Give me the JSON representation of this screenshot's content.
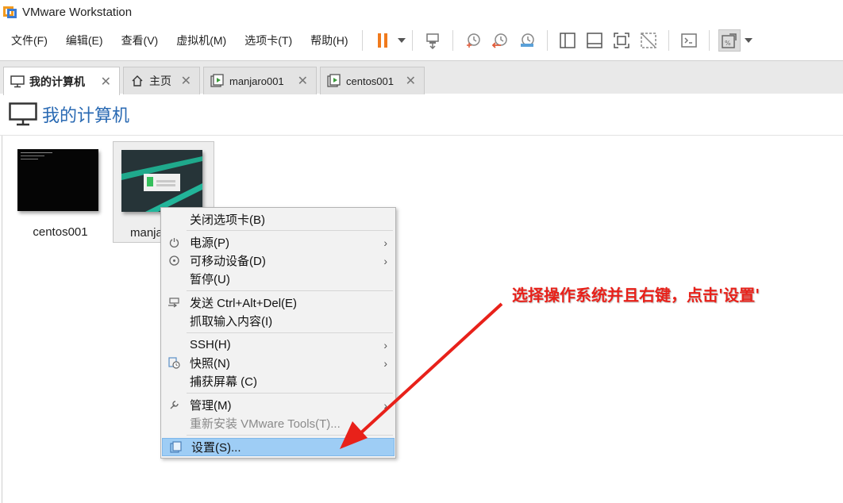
{
  "window": {
    "title": "VMware Workstation"
  },
  "menu": [
    "文件(F)",
    "编辑(E)",
    "查看(V)",
    "虚拟机(M)",
    "选项卡(T)",
    "帮助(H)"
  ],
  "toolbar": {
    "icons": [
      "suspend-icon",
      "send-ctrl-alt-del-icon",
      "snapshot-icon",
      "revert-snapshot-icon",
      "snapshot-manager-icon",
      "library-view-icon",
      "thumbnail-bar-icon",
      "full-screen-icon",
      "unity-icon",
      "console-icon",
      "stretch-guest-icon"
    ],
    "accent": "#f07a1d"
  },
  "tabs": [
    {
      "label": "我的计算机",
      "icon": "monitor-icon",
      "active": true
    },
    {
      "label": "主页",
      "icon": "home-icon",
      "active": false
    },
    {
      "label": "manjaro001",
      "icon": "vm-icon",
      "active": false
    },
    {
      "label": "centos001",
      "icon": "vm-icon",
      "active": false
    }
  ],
  "page": {
    "title": "我的计算机"
  },
  "vms": [
    {
      "name": "centos001",
      "selected": false
    },
    {
      "name": "manja",
      "selected": true
    }
  ],
  "context_menu": {
    "items": [
      {
        "label": "关闭选项卡(B)",
        "icon": "",
        "submenu": false,
        "disabled": false
      },
      {
        "label": "电源(P)",
        "icon": "power-icon",
        "submenu": true,
        "disabled": false
      },
      {
        "label": "可移动设备(D)",
        "icon": "removable-device-icon",
        "submenu": true,
        "disabled": false
      },
      {
        "label": "暂停(U)",
        "icon": "",
        "submenu": false,
        "disabled": false
      },
      {
        "label": "发送 Ctrl+Alt+Del(E)",
        "icon": "send-keys-icon",
        "submenu": false,
        "disabled": false
      },
      {
        "label": "抓取输入内容(I)",
        "icon": "",
        "submenu": false,
        "disabled": false
      },
      {
        "label": "SSH(H)",
        "icon": "",
        "submenu": true,
        "disabled": false
      },
      {
        "label": "快照(N)",
        "icon": "snapshot-icon",
        "submenu": true,
        "disabled": false
      },
      {
        "label": "捕获屏幕 (C)",
        "icon": "",
        "submenu": false,
        "disabled": false
      },
      {
        "label": "管理(M)",
        "icon": "wrench-icon",
        "submenu": true,
        "disabled": false
      },
      {
        "label": "重新安装 VMware Tools(T)...",
        "icon": "",
        "submenu": false,
        "disabled": true
      },
      {
        "label": "设置(S)...",
        "icon": "settings-icon",
        "submenu": false,
        "disabled": false,
        "highlight": true
      }
    ]
  },
  "annotation": {
    "text": "选择操作系统并且右键，点击'设置'",
    "color": "#e8211a"
  }
}
